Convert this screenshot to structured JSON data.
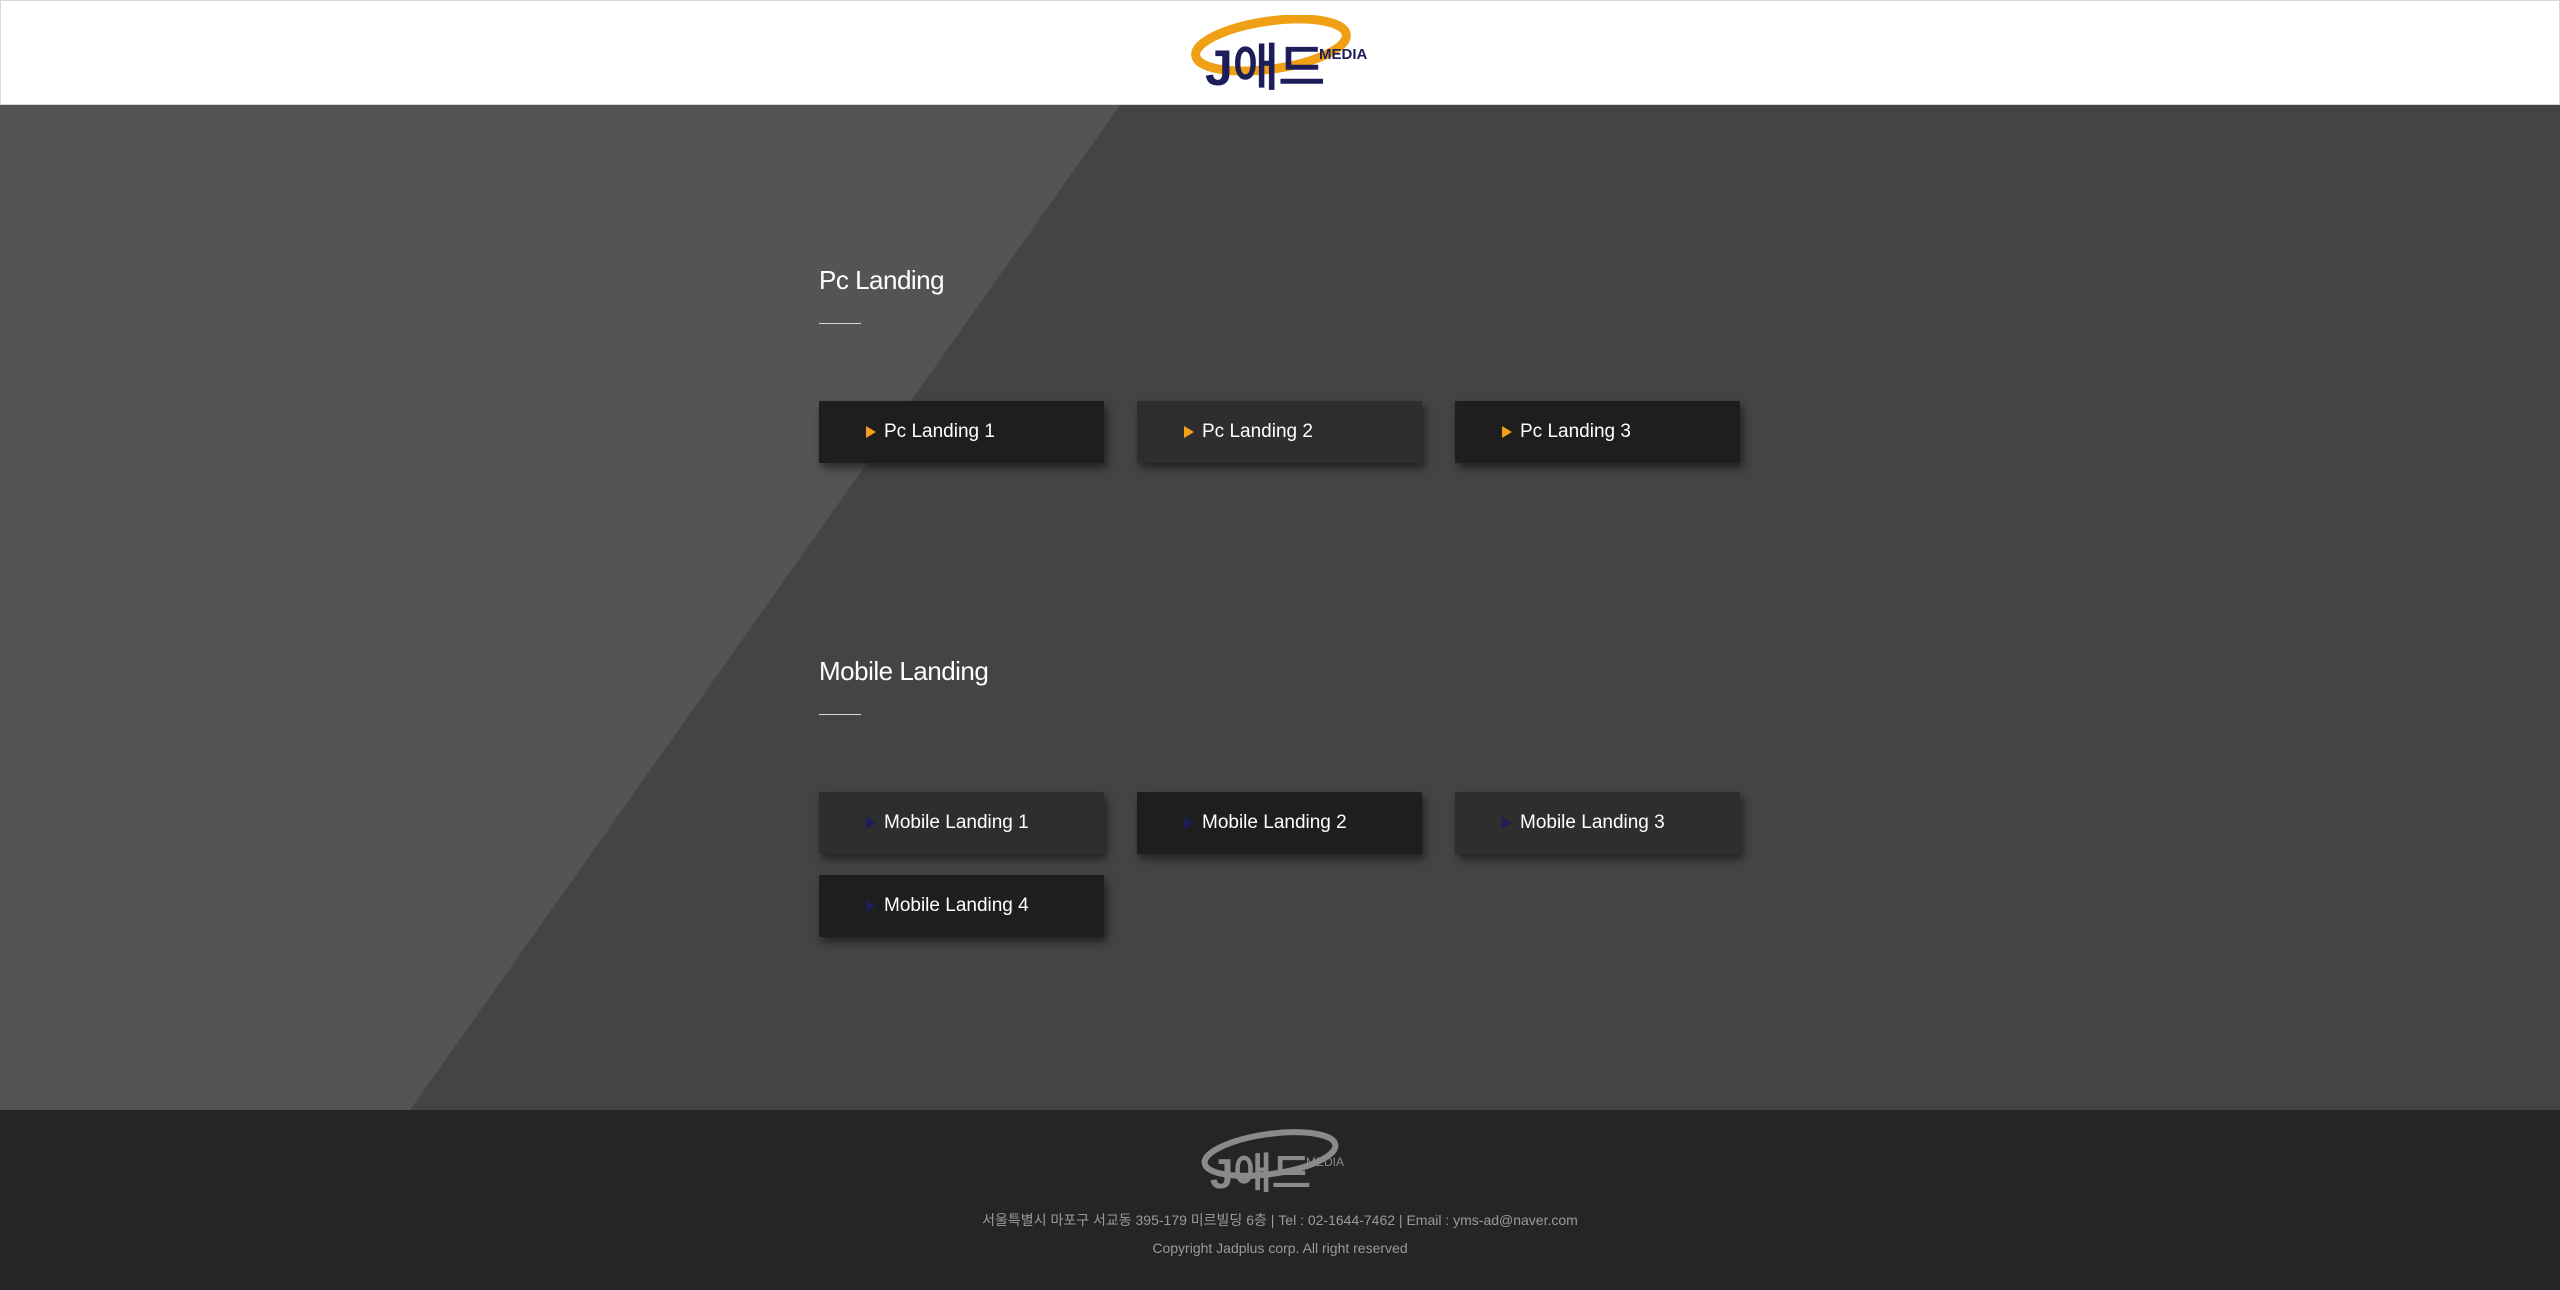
{
  "header": {
    "logo_text": "J애드",
    "logo_sub": "MEDIA"
  },
  "pc_section": {
    "title": "Pc Landing",
    "buttons": [
      {
        "label": "Pc Landing 1"
      },
      {
        "label": "Pc Landing 2"
      },
      {
        "label": "Pc Landing 3"
      }
    ]
  },
  "mobile_section": {
    "title": "Mobile Landing",
    "buttons": [
      {
        "label": "Mobile Landing 1"
      },
      {
        "label": "Mobile Landing 2"
      },
      {
        "label": "Mobile Landing 3"
      },
      {
        "label": "Mobile Landing 4"
      }
    ]
  },
  "footer": {
    "logo_text": "J애드",
    "logo_sub": "MEDIA",
    "address": "서울특별시 마포구 서교동 395-179 미르빌딩 6층 | Tel : 02-1644-7462 | Email : yms-ad@naver.com",
    "copyright": "Copyright Jadplus corp. All right reserved"
  },
  "colors": {
    "accent_orange": "#f0a014",
    "logo_navy": "#1d1d5a"
  }
}
